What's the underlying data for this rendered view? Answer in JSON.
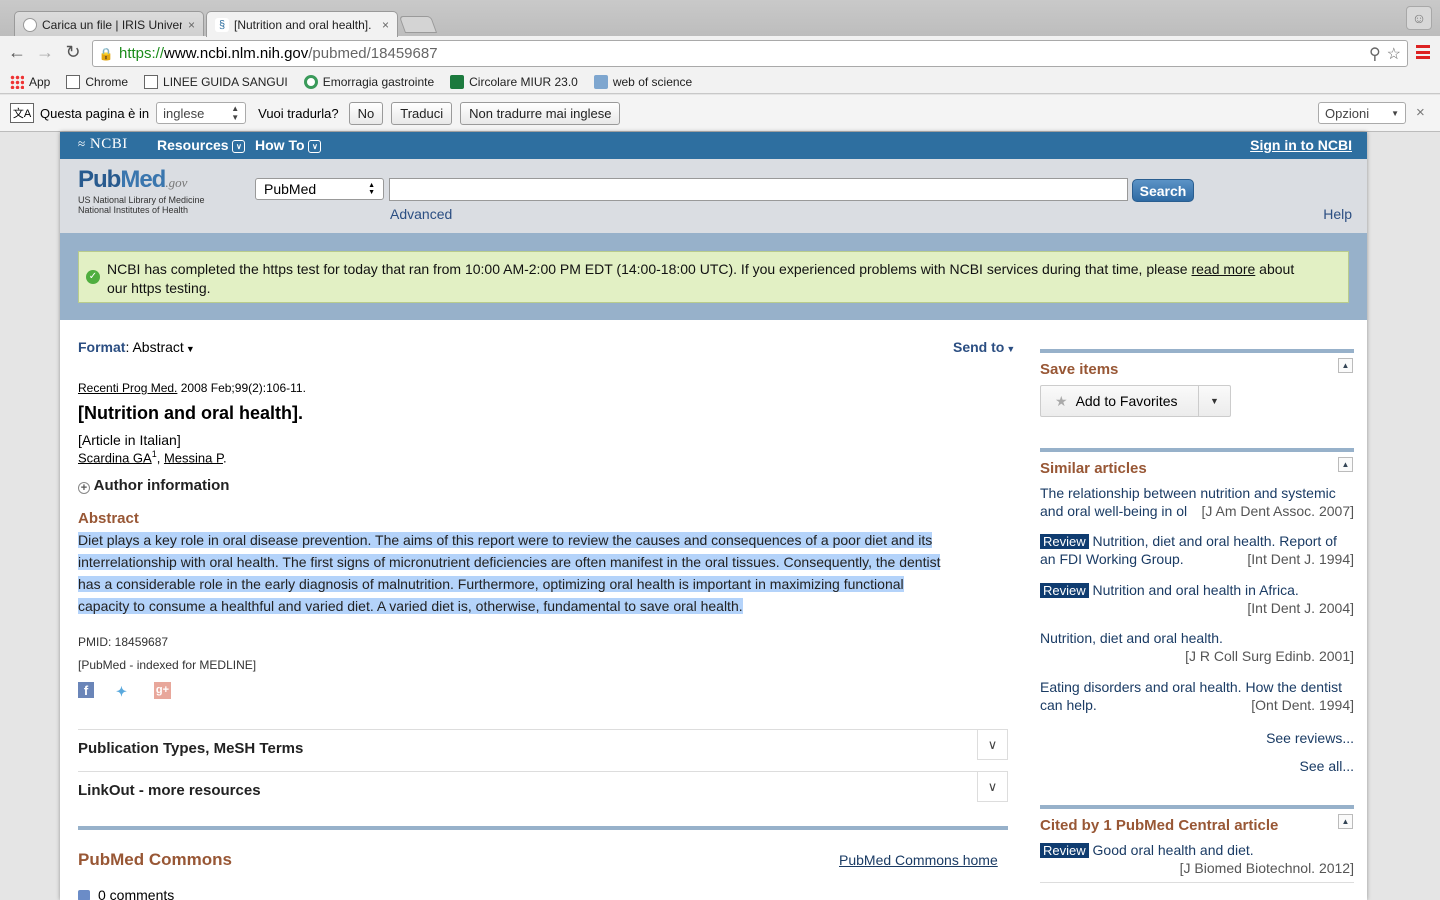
{
  "browser": {
    "tabs": [
      {
        "title": "Carica un file | IRIS Univers",
        "active": false,
        "close": "×"
      },
      {
        "title": "[Nutrition and oral health]. ",
        "active": true,
        "close": "×"
      }
    ],
    "url": {
      "scheme": "https://",
      "host": "www.ncbi.nlm.nih.gov",
      "path": "/pubmed/18459687"
    },
    "bookmarks": [
      "App",
      "Chrome",
      "LINEE GUIDA SANGUI",
      "Emorragia gastrointe",
      "Circolare MIUR 23.0",
      "web of science"
    ],
    "icons": {
      "back": "back-arrow-icon",
      "forward": "forward-arrow-icon",
      "reload": "reload-icon",
      "zoom": "zoom-icon",
      "star": "star-icon",
      "menu": "menu-icon"
    }
  },
  "translate_bar": {
    "prompt": "Questa pagina è in",
    "language": "inglese",
    "question": "Vuoi tradurla?",
    "no": "No",
    "translate": "Traduci",
    "never": "Non tradurre mai inglese",
    "options": "Opzioni",
    "close": "×"
  },
  "ncbi_bar": {
    "logo": "NCBI",
    "resources": "Resources",
    "howto": "How To",
    "signin": "Sign in to NCBI"
  },
  "search": {
    "logo_pub": "Pub",
    "logo_med": "Med",
    "logo_gov": ".gov",
    "logo_line1": "US National Library of Medicine",
    "logo_line2": "National Institutes of Health",
    "database": "PubMed",
    "query": "",
    "button": "Search",
    "advanced": "Advanced",
    "help": "Help"
  },
  "banner": {
    "text_before": "NCBI has completed the https test for today that ran from 10:00 AM-2:00 PM EDT (14:00-18:00 UTC). If you experienced problems with NCBI services during that time, please ",
    "link": "read more",
    "text_after": " about",
    "line2": "our https testing."
  },
  "article": {
    "format_label": "Format",
    "format_value": "Abstract",
    "send_to": "Send to",
    "journal": "Recenti Prog Med.",
    "citation": " 2008 Feb;99(2):106-11.",
    "title": "[Nutrition and oral health].",
    "language_note": "[Article in Italian]",
    "author1": "Scardina GA",
    "author1_sup": "1",
    "author2": "Messina P",
    "author_info": "Author information",
    "abstract_heading": "Abstract",
    "abstract_lines": [
      "Diet plays a key role in oral disease prevention. The aims of this report were to review the causes and consequences of a poor diet and its",
      "interrelationship with oral health. The first signs of micronutrient deficiencies are often manifest in the oral tissues. Consequently, the dentist",
      "has a considerable role in the early diagnosis of malnutrition. Furthermore, optimizing oral health is important in maximizing functional",
      "capacity to consume a healthful and varied diet. A varied diet is, otherwise, fundamental to save oral health."
    ],
    "pmid": "PMID: 18459687",
    "indexed": "[PubMed - indexed for MEDLINE]",
    "pub_types": "Publication Types, MeSH Terms",
    "linkout": "LinkOut - more resources",
    "commons_title": "PubMed Commons",
    "commons_home": "PubMed Commons home",
    "comments": "0 comments"
  },
  "sidebar": {
    "save_items": "Save items",
    "add_favorites": "Add to Favorites",
    "similar_title": "Similar articles",
    "similar": [
      {
        "review": "",
        "title": "The relationship between nutrition and systemic and oral well-being in ol",
        "cite": "[J Am Dent Assoc. 2007]"
      },
      {
        "review": "Review",
        "title": "Nutrition, diet and oral health. Report of an FDI Working Group.",
        "cite": "[Int Dent J. 1994]"
      },
      {
        "review": "Review",
        "title": "Nutrition and oral health in Africa.",
        "cite": "[Int Dent J. 2004]"
      },
      {
        "review": "",
        "title": "Nutrition, diet and oral health.",
        "cite": "[J R Coll Surg Edinb. 2001]"
      },
      {
        "review": "",
        "title": "Eating disorders and oral health. How the dentist can help.",
        "cite": "[Ont Dent. 1994]"
      }
    ],
    "see_reviews": "See reviews...",
    "see_all": "See all...",
    "cited_title": "Cited by 1 PubMed Central article",
    "cited": {
      "review": "Review",
      "title": "Good oral health and diet.",
      "cite": "[J Biomed Biotechnol. 2012]"
    }
  }
}
